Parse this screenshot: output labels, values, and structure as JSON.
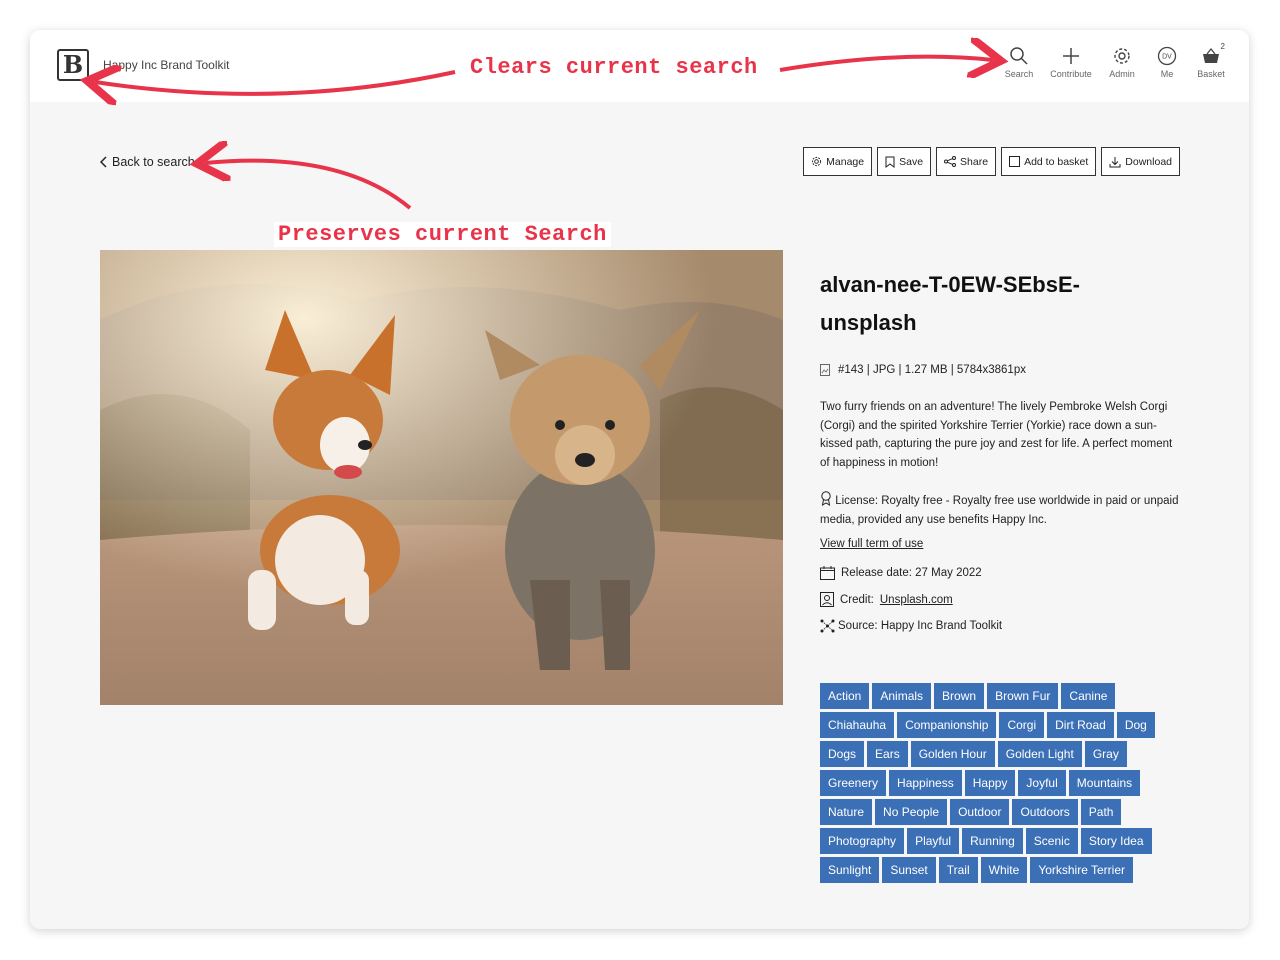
{
  "header": {
    "brand_name": "Happy Inc Brand Toolkit",
    "logo_letter": "B",
    "nav": [
      {
        "label": "Search",
        "icon": "search-icon"
      },
      {
        "label": "Contribute",
        "icon": "plus-icon"
      },
      {
        "label": "Admin",
        "icon": "gear-icon"
      },
      {
        "label": "Me",
        "icon": "avatar-icon",
        "initials": "DV"
      },
      {
        "label": "Basket",
        "icon": "basket-icon",
        "count": "2"
      }
    ]
  },
  "back_link": "Back to search",
  "actions": [
    {
      "label": "Manage",
      "icon": "gear-icon"
    },
    {
      "label": "Save",
      "icon": "bookmark-icon"
    },
    {
      "label": "Share",
      "icon": "share-icon"
    },
    {
      "label": "Add to basket",
      "icon": "checkbox-icon"
    },
    {
      "label": "Download",
      "icon": "download-icon"
    }
  ],
  "asset": {
    "title_line1": "alvan-nee-T-0EW-SEbsE-",
    "title_line2": "unsplash",
    "meta": "#143 | JPG | 1.27 MB | 5784x3861px",
    "description": "Two furry friends on an adventure! The lively Pembroke Welsh Corgi (Corgi) and the spirited Yorkshire Terrier (Yorkie) race down a sun-kissed path, capturing the pure joy and zest for life. A perfect moment of happiness in motion!",
    "license": "License: Royalty free - Royalty free use worldwide in paid or unpaid media, provided any use benefits Happy Inc.",
    "terms_link": "View full term of use",
    "release_date": "Release date: 27 May 2022",
    "credit_label": "Credit:",
    "credit_link": "Unsplash.com",
    "source": "Source: Happy Inc Brand Toolkit"
  },
  "tags": [
    "Action",
    "Animals",
    "Brown",
    "Brown Fur",
    "Canine",
    "Chiahauha",
    "Companionship",
    "Corgi",
    "Dirt Road",
    "Dog",
    "Dogs",
    "Ears",
    "Golden Hour",
    "Golden Light",
    "Gray",
    "Greenery",
    "Happiness",
    "Happy",
    "Joyful",
    "Mountains",
    "Nature",
    "No People",
    "Outdoor",
    "Outdoors",
    "Path",
    "Photography",
    "Playful",
    "Running",
    "Scenic",
    "Story Idea",
    "Sunlight",
    "Sunset",
    "Trail",
    "White",
    "Yorkshire Terrier"
  ],
  "annotations": {
    "clears": "Clears current search",
    "preserves": "Preserves current Search"
  },
  "colors": {
    "tag_bg": "#3b6fb6",
    "annotation": "#e8344a"
  }
}
